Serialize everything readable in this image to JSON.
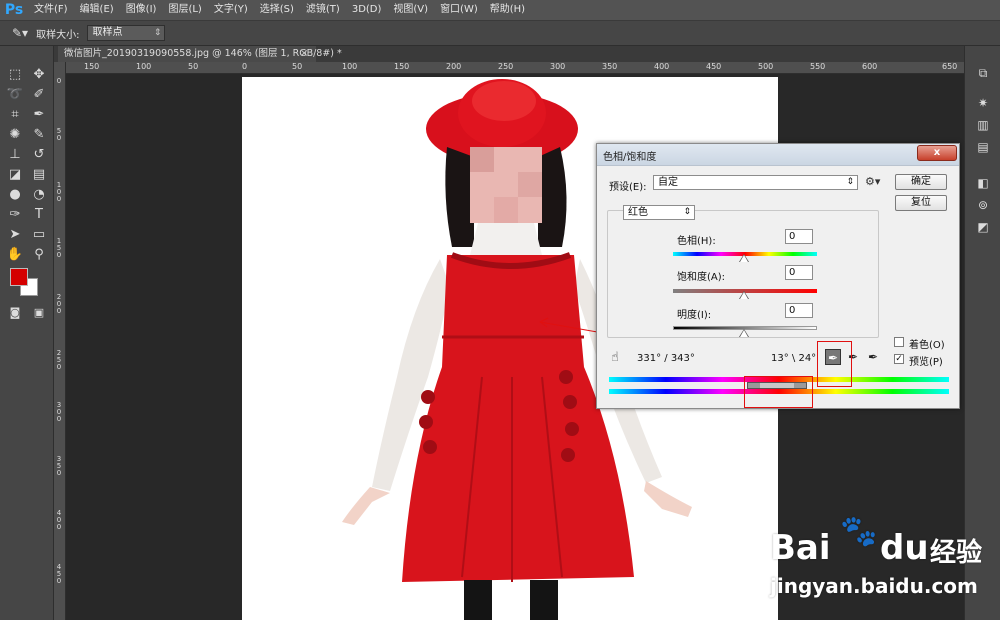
{
  "app": {
    "logo": "Ps"
  },
  "menu": [
    "文件(F)",
    "编辑(E)",
    "图像(I)",
    "图层(L)",
    "文字(Y)",
    "选择(S)",
    "滤镜(T)",
    "3D(D)",
    "视图(V)",
    "窗口(W)",
    "帮助(H)"
  ],
  "options": {
    "sample_size_label": "取样大小:",
    "sample_size_value": "取样点"
  },
  "document": {
    "tab_title": "微信图片_20190319090558.jpg @ 146% (图层 1, RGB/8#) *",
    "tab_close": "×",
    "ruler_top": [
      "150",
      "100",
      "50",
      "0",
      "50",
      "100",
      "150",
      "200",
      "250",
      "300",
      "350",
      "400",
      "450",
      "500",
      "550",
      "600",
      "650"
    ],
    "ruler_left": [
      "0",
      "5\n0",
      "1\n0\n0",
      "1\n5\n0",
      "2\n0\n0",
      "2\n5\n0",
      "3\n0\n0",
      "3\n5\n0",
      "4\n0\n0",
      "4\n5\n0"
    ]
  },
  "dialog": {
    "title": "色相/饱和度",
    "close": "x",
    "preset_label": "预设(E):",
    "preset_value": "自定",
    "ok_button": "确定",
    "reset_button": "复位",
    "channel_value": "红色",
    "hue_label": "色相(H):",
    "hue_value": "0",
    "saturation_label": "饱和度(A):",
    "saturation_value": "0",
    "lightness_label": "明度(I):",
    "lightness_value": "0",
    "range_left": "331° / 343°",
    "range_right": "13° \\ 24°",
    "colorize_label": "着色(O)",
    "colorize_checked": false,
    "preview_label": "预览(P)",
    "preview_checked": true
  },
  "watermark": {
    "brand": "Bai",
    "brand2": "du",
    "jingyan": "经验",
    "url": "jingyan.baidu.com"
  },
  "colors": {
    "foreground": "#d40000",
    "background": "#ffffff",
    "accent_red": "#e01010"
  },
  "icons": [
    "eyedropper-icon",
    "marquee-icon",
    "move-icon",
    "lasso-icon",
    "quick-select-icon",
    "crop-icon",
    "eyedropper-tool-icon",
    "healing-icon",
    "brush-icon",
    "stamp-icon",
    "history-brush-icon",
    "eraser-icon",
    "gradient-icon",
    "blur-icon",
    "dodge-icon",
    "pen-icon",
    "type-icon",
    "path-select-icon",
    "shape-icon",
    "hand-icon",
    "zoom-icon",
    "hand-target-icon",
    "sample-eyedropper-icon",
    "add-sample-icon",
    "subtract-sample-icon",
    "settings-gear-icon"
  ]
}
